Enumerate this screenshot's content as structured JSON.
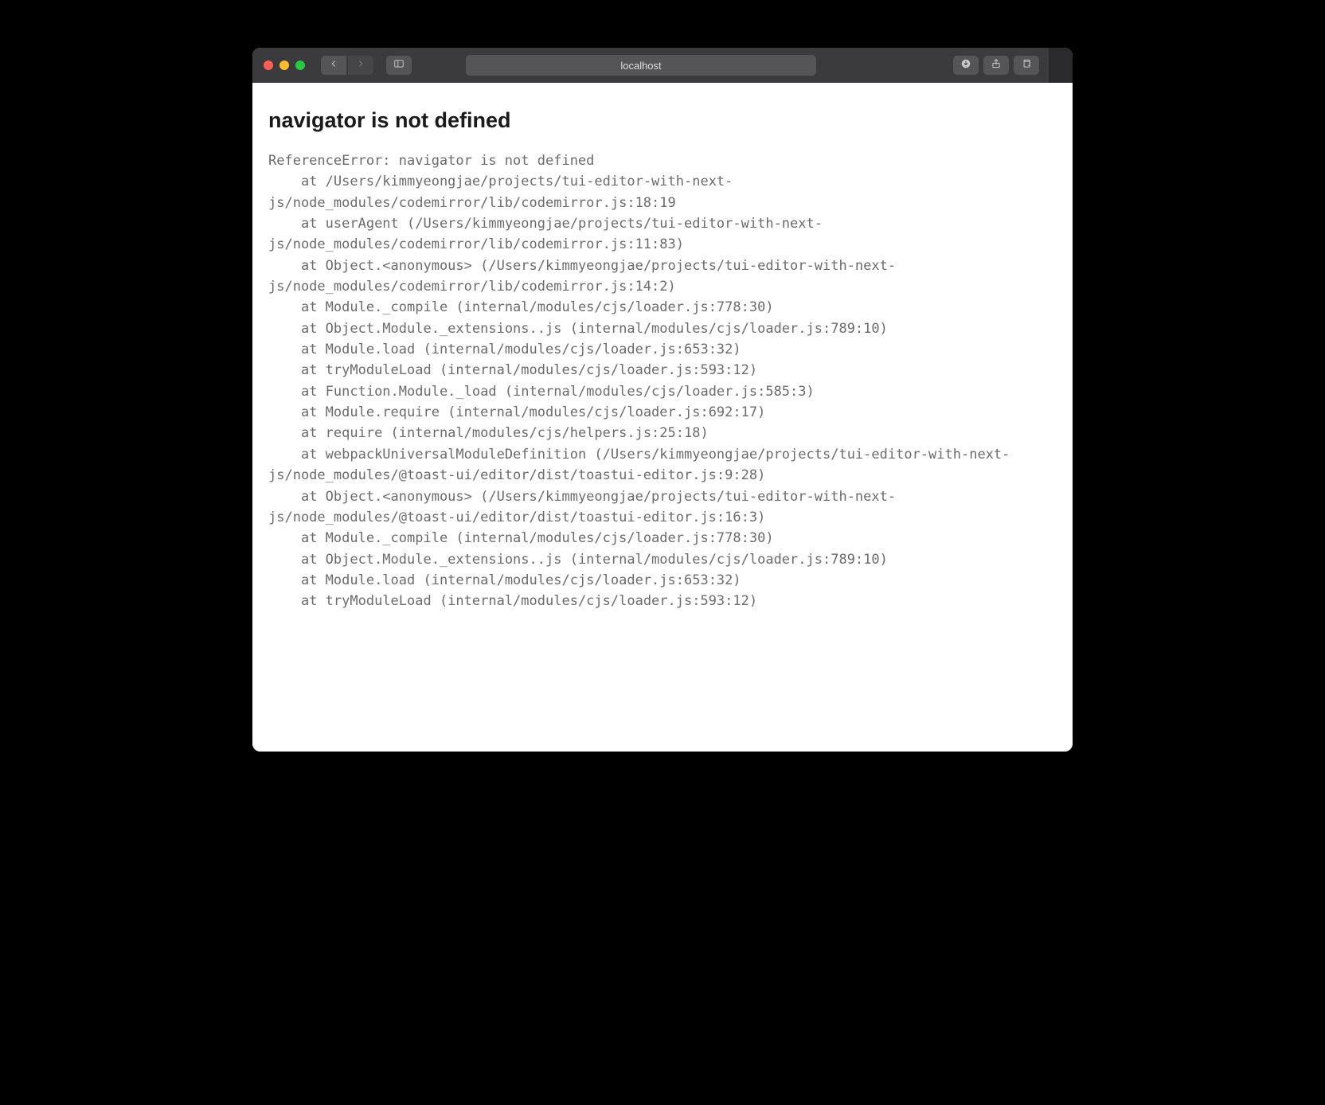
{
  "browser": {
    "address": "localhost"
  },
  "page": {
    "title": "navigator is not defined",
    "stack_lines": [
      "ReferenceError: navigator is not defined",
      "    at /Users/kimmyeongjae/projects/tui-editor-with-next-js/node_modules/codemirror/lib/codemirror.js:18:19",
      "    at userAgent (/Users/kimmyeongjae/projects/tui-editor-with-next-js/node_modules/codemirror/lib/codemirror.js:11:83)",
      "    at Object.<anonymous> (/Users/kimmyeongjae/projects/tui-editor-with-next-js/node_modules/codemirror/lib/codemirror.js:14:2)",
      "    at Module._compile (internal/modules/cjs/loader.js:778:30)",
      "    at Object.Module._extensions..js (internal/modules/cjs/loader.js:789:10)",
      "    at Module.load (internal/modules/cjs/loader.js:653:32)",
      "    at tryModuleLoad (internal/modules/cjs/loader.js:593:12)",
      "    at Function.Module._load (internal/modules/cjs/loader.js:585:3)",
      "    at Module.require (internal/modules/cjs/loader.js:692:17)",
      "    at require (internal/modules/cjs/helpers.js:25:18)",
      "    at webpackUniversalModuleDefinition (/Users/kimmyeongjae/projects/tui-editor-with-next-js/node_modules/@toast-ui/editor/dist/toastui-editor.js:9:28)",
      "    at Object.<anonymous> (/Users/kimmyeongjae/projects/tui-editor-with-next-js/node_modules/@toast-ui/editor/dist/toastui-editor.js:16:3)",
      "    at Module._compile (internal/modules/cjs/loader.js:778:30)",
      "    at Object.Module._extensions..js (internal/modules/cjs/loader.js:789:10)",
      "    at Module.load (internal/modules/cjs/loader.js:653:32)",
      "    at tryModuleLoad (internal/modules/cjs/loader.js:593:12)"
    ]
  }
}
